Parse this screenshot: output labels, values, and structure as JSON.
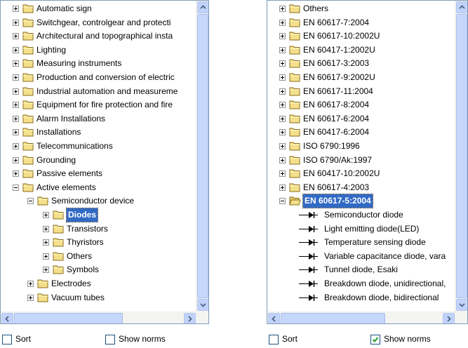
{
  "left_panel": {
    "tree": [
      {
        "label": "Automatic sign",
        "expander": "plus"
      },
      {
        "label": "Switchgear, controlgear and protecti",
        "expander": "plus"
      },
      {
        "label": "Architectural and topographical insta",
        "expander": "plus"
      },
      {
        "label": "Lighting",
        "expander": "plus"
      },
      {
        "label": "Measuring instruments",
        "expander": "plus"
      },
      {
        "label": "Production and conversion of electric",
        "expander": "plus"
      },
      {
        "label": "Industrial automation and measureme",
        "expander": "plus"
      },
      {
        "label": "Equipment for fire protection and fire",
        "expander": "plus"
      },
      {
        "label": "Alarm Installations",
        "expander": "plus"
      },
      {
        "label": "Installations",
        "expander": "plus"
      },
      {
        "label": "Telecommunications",
        "expander": "plus"
      },
      {
        "label": "Grounding",
        "expander": "plus"
      },
      {
        "label": "Passive elements",
        "expander": "plus"
      },
      {
        "label": "Active elements",
        "expander": "minus"
      },
      {
        "label": "Semiconductor device",
        "expander": "minus"
      },
      {
        "label": "Diodes",
        "expander": "plus",
        "selected": true
      },
      {
        "label": "Transistors",
        "expander": "plus"
      },
      {
        "label": "Thyristors",
        "expander": "plus"
      },
      {
        "label": "Others",
        "expander": "plus"
      },
      {
        "label": "Symbols",
        "expander": "plus"
      },
      {
        "label": "Electrodes",
        "expander": "plus"
      },
      {
        "label": "Vacuum tubes",
        "expander": "plus"
      }
    ],
    "sort_label": "Sort",
    "sort_checked": false,
    "show_norms_label": "Show norms",
    "show_norms_checked": false
  },
  "right_panel": {
    "tree": [
      {
        "label": "Others",
        "expander": "plus"
      },
      {
        "label": "EN 60617-7:2004",
        "expander": "plus"
      },
      {
        "label": "EN 60617-10:2002U",
        "expander": "plus"
      },
      {
        "label": "EN 60417-1:2002U",
        "expander": "plus"
      },
      {
        "label": "EN 60617-3:2003",
        "expander": "plus"
      },
      {
        "label": "EN 60617-9:2002U",
        "expander": "plus"
      },
      {
        "label": "EN 60617-11:2004",
        "expander": "plus"
      },
      {
        "label": "EN 60617-8:2004",
        "expander": "plus"
      },
      {
        "label": "EN 60617-6:2004",
        "expander": "plus"
      },
      {
        "label": "EN 60417-6:2004",
        "expander": "plus"
      },
      {
        "label": "ISO 6790:1996",
        "expander": "plus"
      },
      {
        "label": "ISO 6790/Ak:1997",
        "expander": "plus"
      },
      {
        "label": "EN 60417-10:2002U",
        "expander": "plus"
      },
      {
        "label": "EN 60617-4:2003",
        "expander": "plus"
      },
      {
        "label": "EN 60617-5:2004",
        "expander": "minus",
        "selected": true
      },
      {
        "label": "Semiconductor diode",
        "symbol": "diode"
      },
      {
        "label": "Light emitting diode(LED)",
        "symbol": "diode"
      },
      {
        "label": "Temperature sensing diode",
        "symbol": "diode"
      },
      {
        "label": "Variable capacitance diode, vara",
        "symbol": "diode"
      },
      {
        "label": "Tunnel diode, Esaki",
        "symbol": "diode"
      },
      {
        "label": "Breakdown diode, unidirectional,",
        "symbol": "diode"
      },
      {
        "label": "Breakdown diode, bidirectional",
        "symbol": "diode"
      }
    ],
    "sort_label": "Sort",
    "sort_checked": false,
    "show_norms_label": "Show norms",
    "show_norms_checked": true
  },
  "colors": {
    "selection": "#316ac5",
    "border": "#7f9db9",
    "folder": "#f4e08a"
  },
  "icons": [
    "folder-icon",
    "folder-open-icon",
    "diode-symbol-icon",
    "scroll-up-arrow-icon",
    "scroll-down-arrow-icon",
    "scroll-left-arrow-icon",
    "scroll-right-arrow-icon",
    "checkmark-icon"
  ]
}
